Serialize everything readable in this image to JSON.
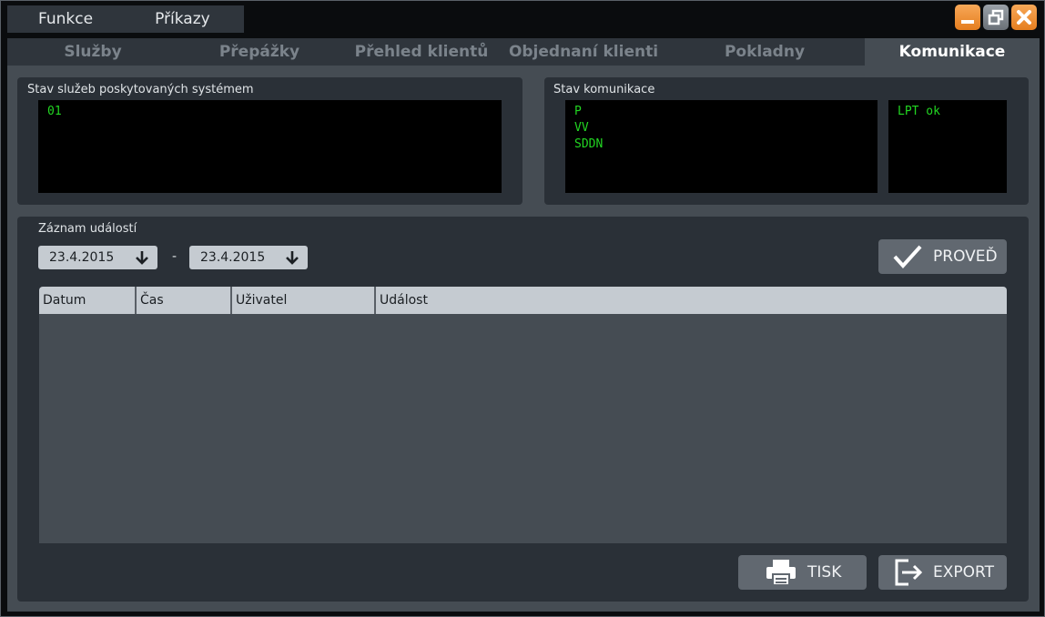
{
  "menu": {
    "items": [
      "Funkce",
      "Příkazy"
    ]
  },
  "tabs": [
    "Služby",
    "Přepážky",
    "Přehled klientů",
    "Objednaní klienti",
    "Pokladny",
    "Komunikace"
  ],
  "active_tab": "Komunikace",
  "services_panel": {
    "title": "Stav služeb poskytovaných systémem",
    "lines": [
      "01"
    ]
  },
  "comm_panel": {
    "title": "Stav komunikace",
    "left_lines": [
      "P",
      "VV",
      "SDDN"
    ],
    "right_lines": [
      "LPT ok"
    ]
  },
  "events": {
    "title": "Záznam událostí",
    "date_from": "23.4.2015",
    "separator": "-",
    "date_to": "23.4.2015",
    "run_label": "PROVEĎ",
    "columns": [
      "Datum",
      "Čas",
      "Uživatel",
      "Událost"
    ],
    "rows": [],
    "print_label": "TISK",
    "export_label": "EXPORT"
  },
  "icons": [
    "minimize-icon",
    "restore-icon",
    "close-icon",
    "arrow-down-icon",
    "checkmark-icon",
    "printer-icon",
    "export-icon"
  ],
  "colors": {
    "accent_orange": "#f08a24",
    "terminal_green": "#22d622",
    "background": "#454c53"
  }
}
